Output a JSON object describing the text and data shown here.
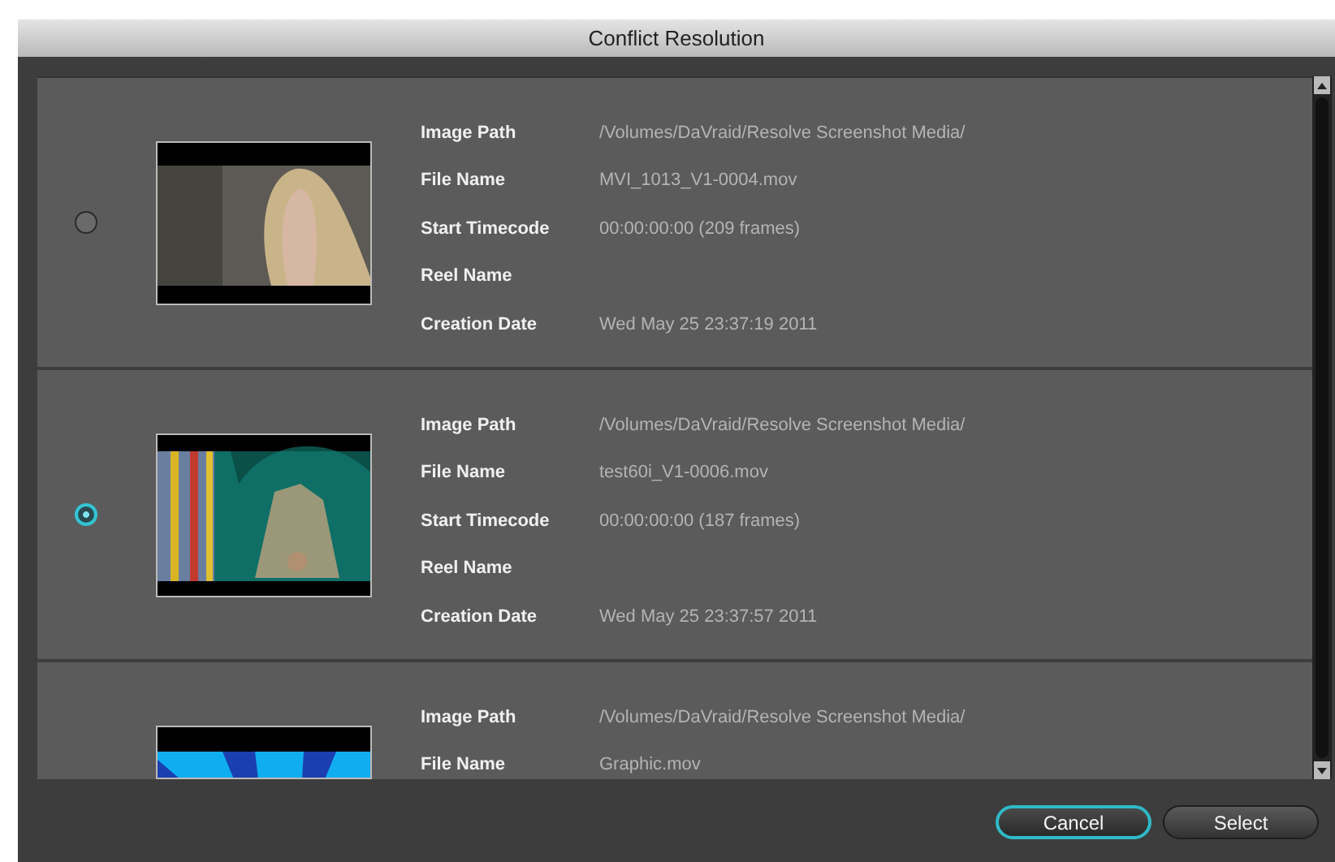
{
  "window": {
    "title": "Conflict Resolution"
  },
  "clips": [
    {
      "selected": false,
      "thumbnail": {
        "kind": "picture"
      },
      "fields": [
        {
          "label": "Image Path",
          "value": "/Volumes/DaVraid/Resolve Screenshot Media/"
        },
        {
          "label": "File Name",
          "value": "MVI_1013_V1-0004.mov"
        },
        {
          "label": "Start Timecode",
          "value": "00:00:00:00 (209 frames)"
        },
        {
          "label": "Reel Name"
        },
        {
          "label": "Creation Date",
          "value": "Wed May 25 23:37:19 2011"
        }
      ]
    },
    {
      "selected": true,
      "thumbnail": {
        "kind": "picture"
      },
      "fields": [
        {
          "label": "Image Path",
          "value": "/Volumes/DaVraid/Resolve Screenshot Media/"
        },
        {
          "label": "File Name",
          "value": "test60i_V1-0006.mov"
        },
        {
          "label": "Start Timecode",
          "value": "00:00:00:00 (187 frames)"
        },
        {
          "label": "Reel Name"
        },
        {
          "label": "Creation Date",
          "value": "Wed May 25 23:37:57 2011"
        }
      ]
    },
    {
      "thumbnail": {
        "kind": "picture"
      },
      "fields": [
        {
          "label": "Image Path",
          "value": "/Volumes/DaVraid/Resolve Screenshot Media/"
        },
        {
          "label": "File Name",
          "value": "Graphic.mov"
        }
      ]
    }
  ],
  "buttons": [
    {
      "label": "Cancel",
      "default": true
    },
    {
      "label": "Select",
      "default": false
    }
  ]
}
